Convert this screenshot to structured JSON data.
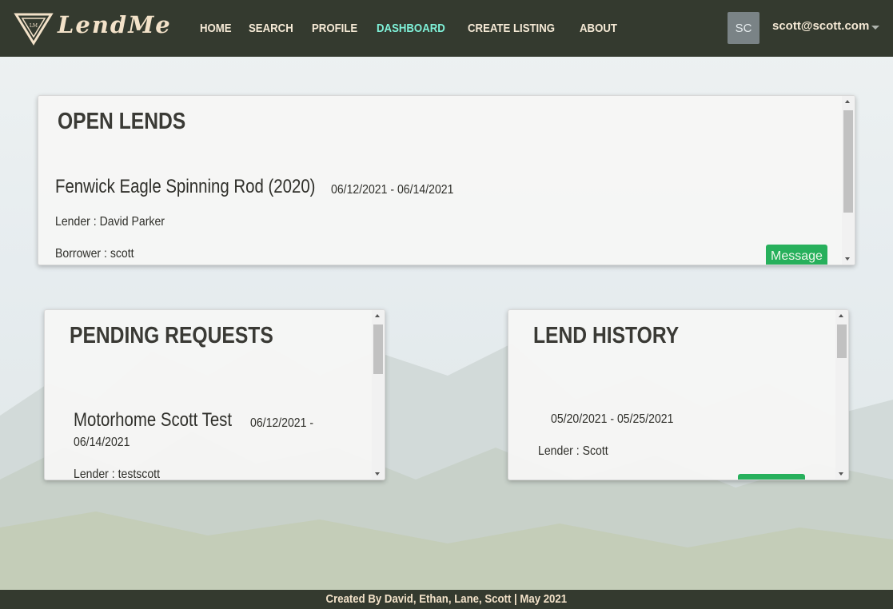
{
  "brand": {
    "name": "LendMe"
  },
  "nav": {
    "items": [
      {
        "label": "HOME"
      },
      {
        "label": "SEARCH"
      },
      {
        "label": "PROFILE"
      },
      {
        "label": "DASHBOARD",
        "active": true
      },
      {
        "label": "CREATE LISTING"
      },
      {
        "label": "ABOUT"
      }
    ]
  },
  "user": {
    "initials": "SC",
    "email": "scott@scott.com"
  },
  "open_lends": {
    "title": "OPEN LENDS",
    "item": {
      "title": "Fenwick Eagle Spinning Rod (2020)",
      "dates": "06/12/2021 - 06/14/2021",
      "lender": "Lender : David Parker",
      "borrower": "Borrower : scott",
      "button": "Message"
    }
  },
  "pending_requests": {
    "title": "PENDING REQUESTS",
    "item": {
      "title": "Motorhome Scott Test",
      "dates_start": "06/12/2021 -",
      "dates_end": "06/14/2021",
      "lender": "Lender : testscott"
    }
  },
  "lend_history": {
    "title": "LEND HISTORY",
    "item": {
      "dates": "05/20/2021 - 05/25/2021",
      "lender": "Lender : Scott"
    }
  },
  "footer": {
    "text": "Created By David, Ethan, Lane, Scott | May 2021"
  },
  "colors": {
    "navbar": "#343a2f",
    "nav_text": "#f6ead6",
    "nav_active": "#7ff2d9",
    "button_green": "#27b05c"
  }
}
